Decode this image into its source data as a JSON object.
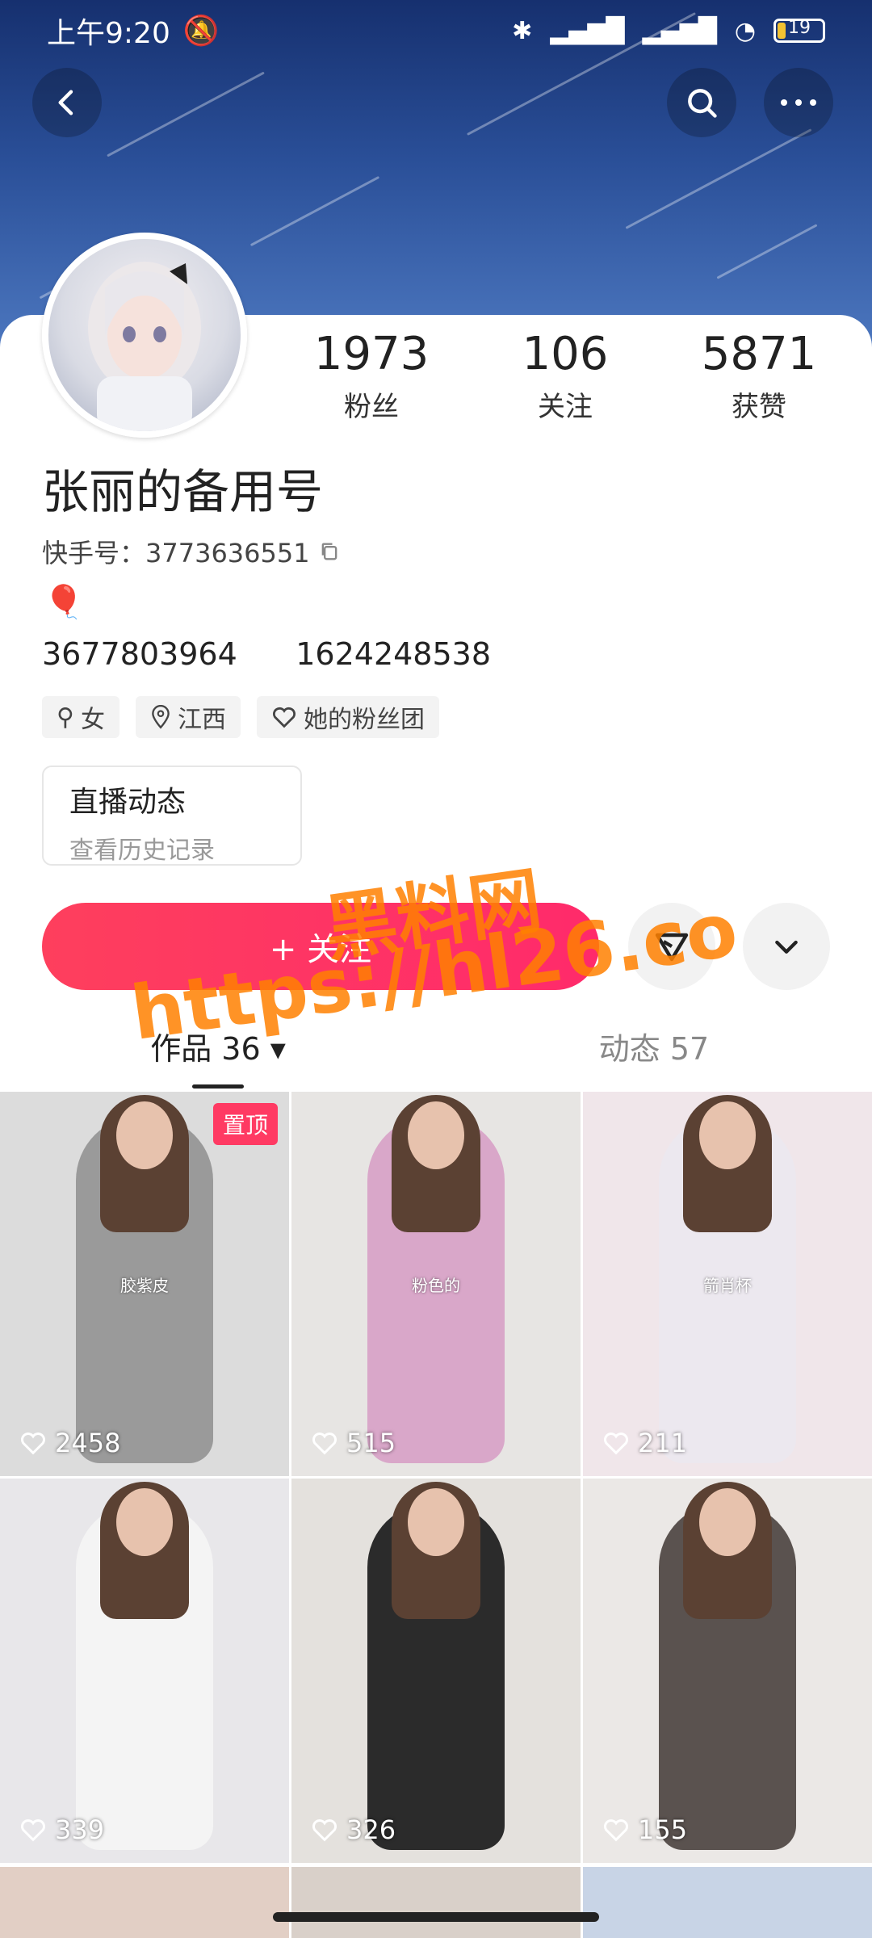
{
  "status_bar": {
    "time": "上午9:20",
    "battery": "19"
  },
  "profile": {
    "name": "张丽的备用号",
    "kwai_id": "快手号：3773636551",
    "bio": "3677803964      1624248538",
    "stats": [
      {
        "num": "1973",
        "label": "粉丝"
      },
      {
        "num": "106",
        "label": "关注"
      },
      {
        "num": "5871",
        "label": "获赞"
      }
    ],
    "tags": [
      {
        "icon": "female-icon",
        "label": "女"
      },
      {
        "icon": "location-icon",
        "label": "江西"
      },
      {
        "icon": "heart-outline-icon",
        "label": "她的粉丝团"
      }
    ],
    "live": {
      "title": "直播动态",
      "subtitle": "查看历史记录"
    },
    "follow_label": "+ 关注"
  },
  "watermark": {
    "line1": "黑料网",
    "line2": "https://hl26.co"
  },
  "tabs": [
    {
      "label": "作品 36",
      "active": true
    },
    {
      "label": "动态 57",
      "active": false
    }
  ],
  "grid": [
    {
      "likes": "2458",
      "pin": "置顶",
      "label": "胶紫皮",
      "bg": "#dcdcdc",
      "outfit": "#9a9a9a"
    },
    {
      "likes": "515",
      "pin": "",
      "label": "粉色的",
      "bg": "#e7e5e3",
      "outfit": "#d9a7c9"
    },
    {
      "likes": "211",
      "pin": "",
      "label": "箭肖杯",
      "bg": "#f0e6ea",
      "outfit": "#ece8ef"
    },
    {
      "likes": "339",
      "pin": "",
      "label": "",
      "bg": "#e8e7ea",
      "outfit": "#f4f4f4"
    },
    {
      "likes": "326",
      "pin": "",
      "label": "",
      "bg": "#e4e1dd",
      "outfit": "#2b2b2b"
    },
    {
      "likes": "155",
      "pin": "",
      "label": "",
      "bg": "#ebe8e6",
      "outfit": "#5a524f"
    }
  ]
}
